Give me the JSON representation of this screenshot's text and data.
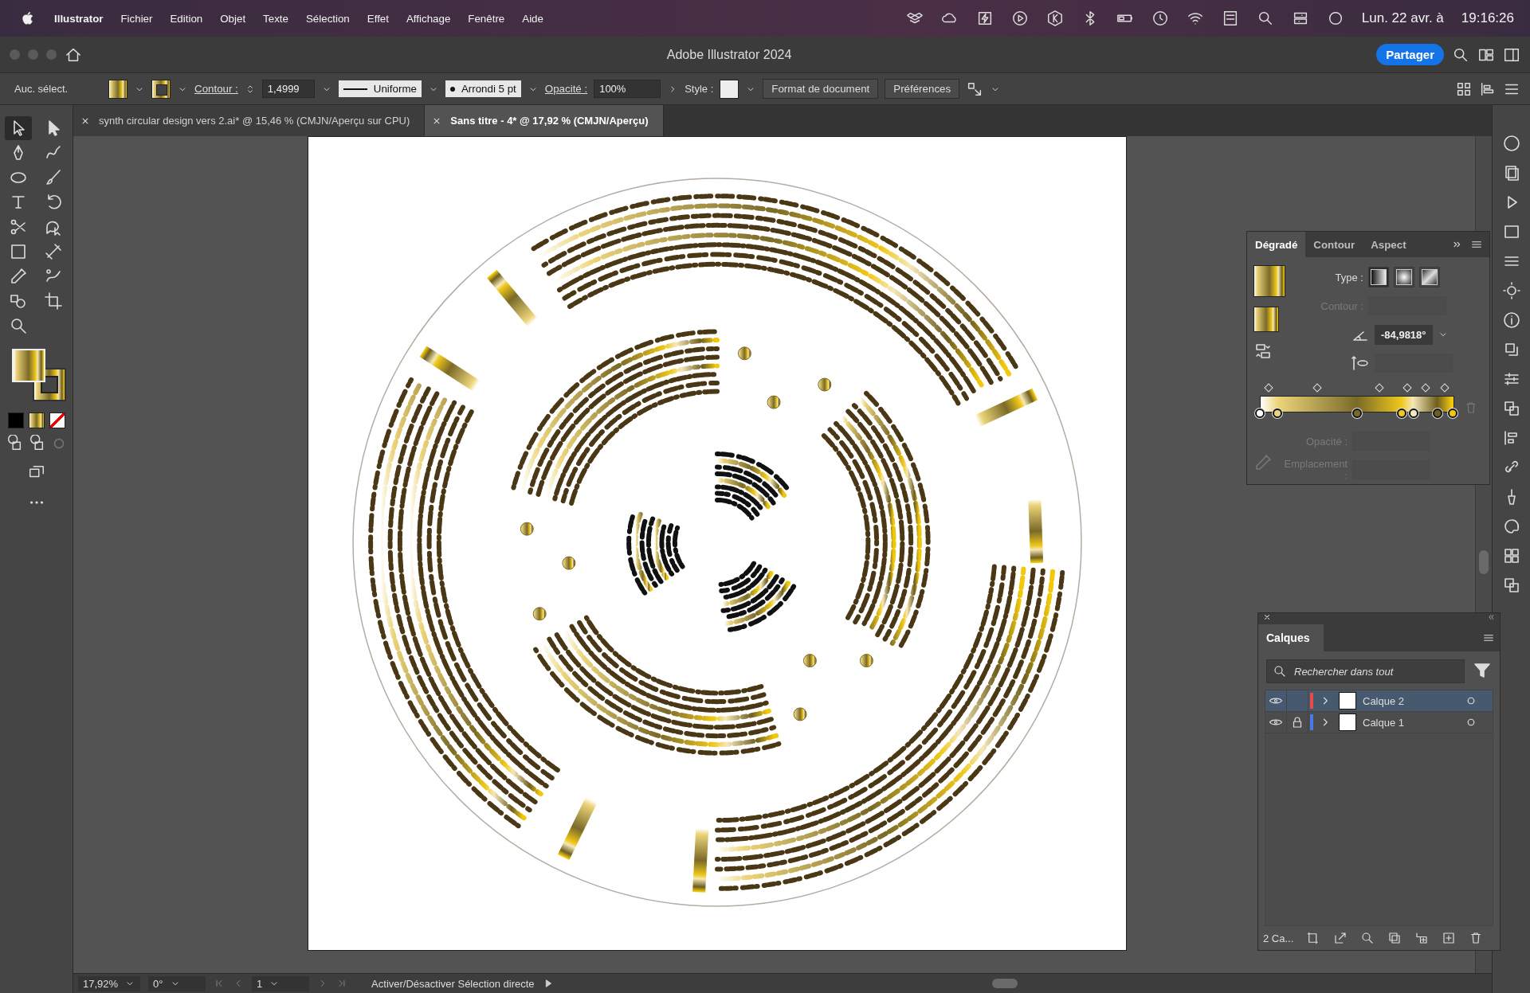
{
  "menu_bar": {
    "app_name": "Illustrator",
    "menus": [
      "Fichier",
      "Edition",
      "Objet",
      "Texte",
      "Sélection",
      "Effet",
      "Affichage",
      "Fenêtre",
      "Aide"
    ],
    "date": "Lun. 22 avr. à",
    "time": "19:16:26"
  },
  "title_bar": {
    "title": "Adobe Illustrator 2024",
    "share_button": "Partager"
  },
  "control_bar": {
    "selection": "Auc. sélect.",
    "stroke_label": "Contour :",
    "stroke_weight": "1,4999",
    "stroke_profile": "Uniforme",
    "brush": "Arrondi 5 pt",
    "opacity_label": "Opacité :",
    "opacity": "100%",
    "style_label": "Style :",
    "document_button": "Format de document",
    "preferences_button": "Préférences"
  },
  "document_tabs": [
    {
      "title": "synth circular design vers 2.ai* @ 15,46 % (CMJN/Aperçu sur CPU)",
      "selected": false
    },
    {
      "title": "Sans titre - 4* @ 17,92 % (CMJN/Aperçu)",
      "selected": true
    }
  ],
  "tools": [
    {
      "kind": "selection",
      "selected": true
    },
    {
      "kind": "direct",
      "selected": false
    },
    {
      "kind": "pen",
      "selected": false
    },
    {
      "kind": "curvature",
      "selected": false
    },
    {
      "kind": "ellipse",
      "selected": false
    },
    {
      "kind": "brush",
      "selected": false
    },
    {
      "kind": "type",
      "selected": false
    },
    {
      "kind": "rotate",
      "selected": false
    },
    {
      "kind": "scissors",
      "selected": false
    },
    {
      "kind": "puppet",
      "selected": false
    },
    {
      "kind": "gradient",
      "selected": false
    },
    {
      "kind": "width",
      "selected": false
    },
    {
      "kind": "eyedropper",
      "selected": false
    },
    {
      "kind": "blend",
      "selected": false
    },
    {
      "kind": "shapebuilder",
      "selected": false
    },
    {
      "kind": "artboard",
      "selected": false
    },
    {
      "kind": "zoom",
      "selected": false
    }
  ],
  "gradient_panel": {
    "tabs": [
      {
        "label": "Dégradé",
        "selected": true
      },
      {
        "label": "Contour",
        "selected": false
      },
      {
        "label": "Aspect",
        "selected": false
      }
    ],
    "type_label": "Type :",
    "types": [
      {
        "kind": "linear",
        "selected": true
      },
      {
        "kind": "radial",
        "selected": false
      },
      {
        "kind": "freeform",
        "selected": false
      }
    ],
    "angle": "-84,9818°",
    "fields": [
      {
        "kind": "stroke",
        "label": "Contour :",
        "disabled": true
      },
      {
        "kind": "opacity",
        "label": "Opacité :",
        "disabled": true
      },
      {
        "kind": "location",
        "label": "Emplacement :",
        "disabled": true
      }
    ],
    "stops": [
      {
        "level": 0,
        "color": "#ffffff"
      },
      {
        "level": 0.09,
        "color": "#ecd47a"
      },
      {
        "level": 0.5,
        "color": "#7a6a28"
      },
      {
        "level": 0.73,
        "color": "#f0c81a"
      },
      {
        "level": 0.79,
        "color": "#f5e8b8"
      },
      {
        "level": 0.915,
        "color": "#6e5e20"
      },
      {
        "level": 0.99,
        "color": "#f2c80c"
      }
    ]
  },
  "layers_panel": {
    "title": "Calques",
    "search_placeholder": "Rechercher dans tout",
    "layers": [
      {
        "name": "Calque 2",
        "selected": true,
        "visible": true,
        "locked": false,
        "color": "#e84a4a"
      },
      {
        "name": "Calque 1",
        "selected": false,
        "visible": true,
        "locked": true,
        "color": "#4a7ae8"
      }
    ],
    "count": "2 Ca..."
  },
  "status_bar": {
    "zoom": "17,92%",
    "rotation": "0°",
    "artboard": "1",
    "info": "Activer/Désactiver Sélection directe"
  }
}
